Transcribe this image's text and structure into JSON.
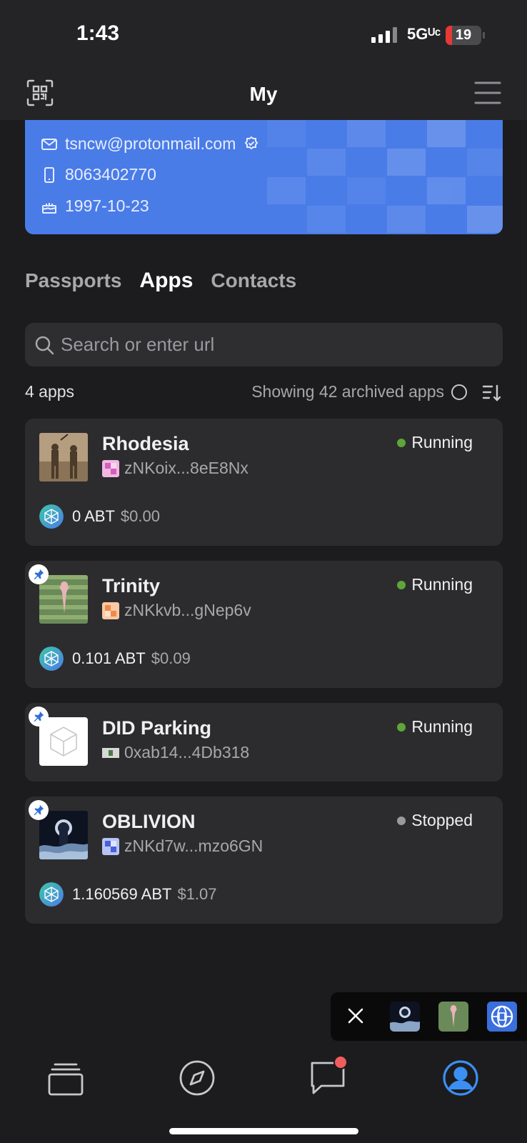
{
  "status_bar": {
    "time": "1:43",
    "network": "5Gᵁᶜ",
    "battery": "19"
  },
  "header": {
    "title": "My",
    "scan_icon": "qr-scan-icon",
    "menu_icon": "menu-icon"
  },
  "profile": {
    "email": "tsncw@protonmail.com",
    "phone": "8063402770",
    "birthday": "1997-10-23",
    "accent_color": "#4a7ce8"
  },
  "tabs": [
    {
      "label": "Passports",
      "active": false
    },
    {
      "label": "Apps",
      "active": true
    },
    {
      "label": "Contacts",
      "active": false
    }
  ],
  "search": {
    "placeholder": "Search or enter url",
    "value": ""
  },
  "list_meta": {
    "count_label": "4 apps",
    "archived_label": "Showing 42 archived apps"
  },
  "apps": [
    {
      "name": "Rhodesia",
      "did": "zNKoix...8eE8Nx",
      "status": "Running",
      "status_color": "#5fa53a",
      "pinned": false,
      "token": "0 ABT",
      "usd": "$0.00"
    },
    {
      "name": "Trinity",
      "did": "zNKkvb...gNep6v",
      "status": "Running",
      "status_color": "#5fa53a",
      "pinned": true,
      "token": "0.101 ABT",
      "usd": "$0.09"
    },
    {
      "name": "DID Parking",
      "did": "0xab14...4Db318",
      "status": "Running",
      "status_color": "#5fa53a",
      "pinned": true
    },
    {
      "name": "OBLIVION",
      "did": "zNKd7w...mzo6GN",
      "status": "Stopped",
      "status_color": "#9a9a9e",
      "pinned": true,
      "token": "1.160569 ABT",
      "usd": "$1.07"
    }
  ],
  "tabbar": {
    "items": [
      "cards-icon",
      "compass-icon",
      "chat-icon",
      "profile-icon"
    ],
    "active": "profile-icon",
    "active_color": "#3b8ff2"
  }
}
